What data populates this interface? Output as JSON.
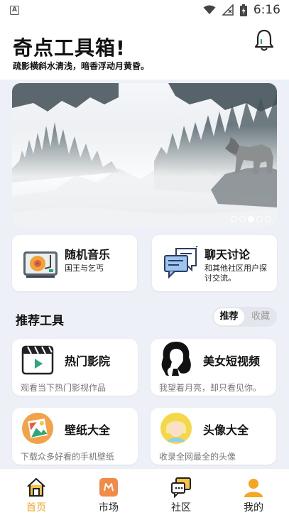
{
  "status_bar": {
    "time": "6:16",
    "app_indicator": "A",
    "icons": [
      "wifi-icon",
      "signal-off-icon",
      "battery-charging-icon"
    ]
  },
  "header": {
    "title": "奇点工具箱!",
    "subtitle": "疏影横斜水清浅，暗香浮动月黄昏。",
    "notification_icon": "bell-icon"
  },
  "banner": {
    "image": "misty-forest-wolf",
    "slide_count": 5,
    "active_slide": 3
  },
  "features": [
    {
      "title": "随机音乐",
      "desc": "国王与乞丐",
      "icon": "record-player-icon"
    },
    {
      "title": "聊天讨论",
      "desc": "和其他社区用户探讨交流。",
      "icon": "chat-bubbles-icon"
    }
  ],
  "section": {
    "title": "推荐工具",
    "tabs": [
      "推荐",
      "收藏"
    ],
    "active_tab": "推荐"
  },
  "tools": [
    {
      "name": "热门影院",
      "desc": "观看当下热门影视作品",
      "icon": "clapperboard-icon"
    },
    {
      "name": "美女短视频",
      "desc": "我望着月亮，却只看见你。",
      "icon": "woman-silhouette-icon"
    },
    {
      "name": "壁纸大全",
      "desc": "下载众多好看的手机壁纸",
      "icon": "wallpaper-icon"
    },
    {
      "name": "头像大全",
      "desc": "收录全网最全的头像",
      "icon": "avatar-icon"
    }
  ],
  "nav": [
    {
      "label": "首页",
      "icon": "home-icon",
      "active": true
    },
    {
      "label": "市场",
      "icon": "market-icon",
      "active": false
    },
    {
      "label": "社区",
      "icon": "community-icon",
      "active": false
    },
    {
      "label": "我的",
      "icon": "profile-icon",
      "active": false
    }
  ],
  "colors": {
    "accent": "#f5a623",
    "background": "#eef0f8",
    "card": "#ffffff"
  }
}
